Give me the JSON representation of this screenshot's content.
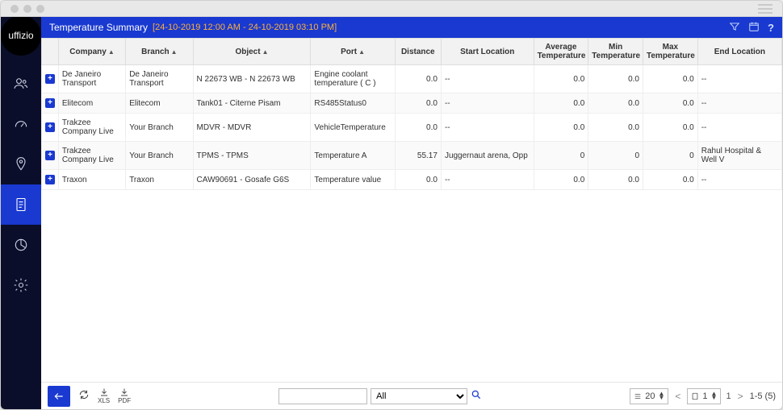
{
  "brand": "uffizio",
  "header": {
    "title": "Temperature Summary",
    "date_range": "[24-10-2019 12:00 AM - 24-10-2019 03:10 PM]"
  },
  "columns": {
    "company": "Company",
    "branch": "Branch",
    "object": "Object",
    "port": "Port",
    "distance": "Distance",
    "start_location": "Start Location",
    "avg_temp": "Average Temperature",
    "min_temp": "Min Temperature",
    "max_temp": "Max Temperature",
    "end_location": "End Location",
    "sort_asc": "▲"
  },
  "rows": [
    {
      "company": "De Janeiro Transport",
      "branch": "De Janeiro Transport",
      "object": "N 22673 WB - N 22673 WB",
      "port": "Engine coolant temperature ( C )",
      "distance": "0.0",
      "start": "--",
      "avg": "0.0",
      "min": "0.0",
      "max": "0.0",
      "end": "--"
    },
    {
      "company": "Elitecom",
      "branch": "Elitecom",
      "object": "Tank01 - Citerne Pisam",
      "port": "RS485Status0",
      "distance": "0.0",
      "start": "--",
      "avg": "0.0",
      "min": "0.0",
      "max": "0.0",
      "end": "--"
    },
    {
      "company": "Trakzee Company Live",
      "branch": "Your Branch",
      "object": "MDVR - MDVR",
      "port": "VehicleTemperature",
      "distance": "0.0",
      "start": "--",
      "avg": "0.0",
      "min": "0.0",
      "max": "0.0",
      "end": "--"
    },
    {
      "company": "Trakzee Company Live",
      "branch": "Your Branch",
      "object": "TPMS - TPMS",
      "port": "Temperature A",
      "distance": "55.17",
      "start": "Juggernaut arena, Opp",
      "avg": "0",
      "min": "0",
      "max": "0",
      "end": "Rahul Hospital & Well V"
    },
    {
      "company": "Traxon",
      "branch": "Traxon",
      "object": "CAW90691 - Gosafe G6S",
      "port": "Temperature value",
      "distance": "0.0",
      "start": "--",
      "avg": "0.0",
      "min": "0.0",
      "max": "0.0",
      "end": "--"
    }
  ],
  "footer": {
    "xls": "XLS",
    "pdf": "PDF",
    "filter_select": "All",
    "search_placeholder": "",
    "page_size": "20",
    "page_current": "1",
    "page_total": "1",
    "range_label": "1-5 (5)"
  }
}
